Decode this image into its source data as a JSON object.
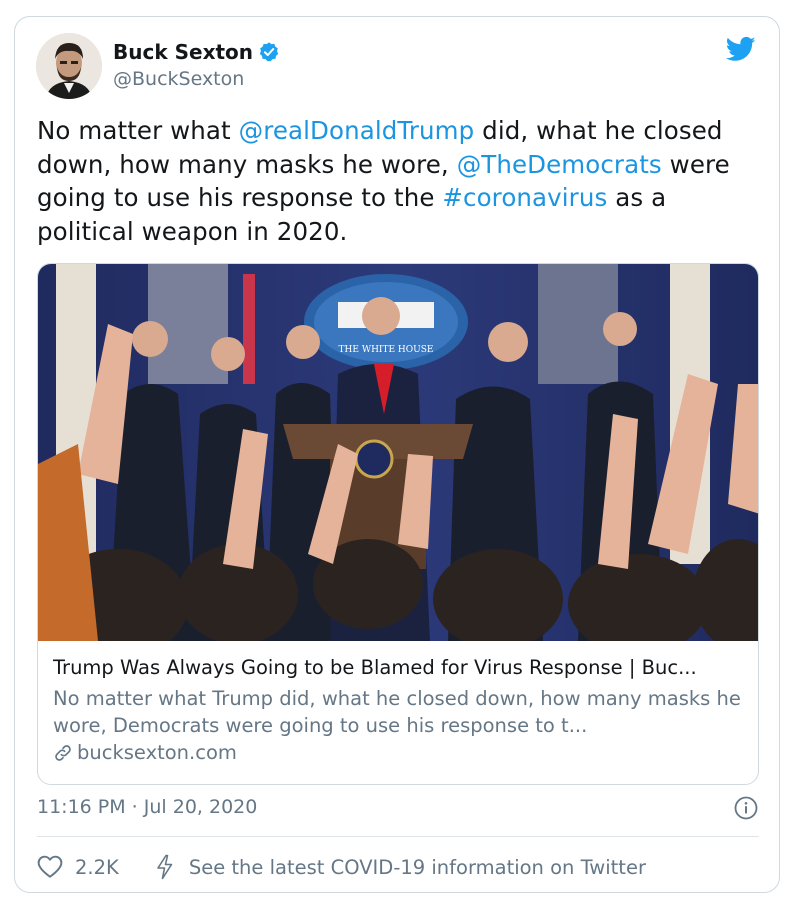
{
  "author": {
    "name": "Buck Sexton",
    "handle": "@BuckSexton",
    "verified": true
  },
  "tweet": {
    "segments": [
      {
        "text": "No matter what ",
        "link": false
      },
      {
        "text": "@realDonaldTrump",
        "link": true
      },
      {
        "text": " did, what he closed down, how many masks he wore, ",
        "link": false
      },
      {
        "text": "@TheDemocrats",
        "link": true
      },
      {
        "text": " were going to use his response to the ",
        "link": false
      },
      {
        "text": "#coronavirus",
        "link": true
      },
      {
        "text": " as a political weapon in 2020.",
        "link": false
      }
    ]
  },
  "link_card": {
    "title": "Trump Was Always Going to be Blamed for Virus Response | Buc...",
    "description": "No matter what Trump did, what he closed down, how many masks he wore, Democrats were going to use his response to t...",
    "domain": "bucksexton.com",
    "podium_sign": "THE WHITE HOUSE"
  },
  "meta": {
    "timestamp": "11:16 PM · Jul 20, 2020"
  },
  "actions": {
    "like_count": "2.2K",
    "covid_notice": "See the latest COVID-19 information on Twitter"
  },
  "colors": {
    "link": "#1b95e0",
    "brand": "#1da1f2",
    "secondary": "#657786",
    "border": "#cfd9de"
  },
  "icons": [
    "verified-icon",
    "twitter-bird-icon",
    "link-icon",
    "info-icon",
    "heart-icon",
    "lightning-icon"
  ]
}
